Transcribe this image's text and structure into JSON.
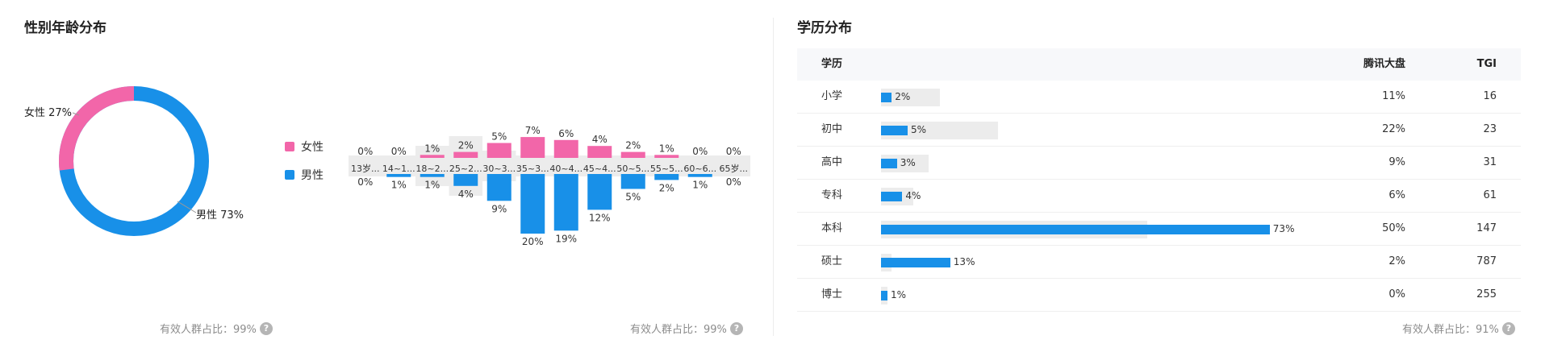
{
  "gender_age": {
    "title": "性别年龄分布",
    "donut": {
      "female_label": "女性 27%",
      "male_label": "男性 73%",
      "female_share": 27,
      "male_share": 73
    },
    "legend": {
      "female": "女性",
      "male": "男性"
    },
    "footer": "有效人群占比：99%"
  },
  "age_chart": {
    "footer": "有效人群占比：99%"
  },
  "education": {
    "title": "学历分布",
    "headers": {
      "name": "学历",
      "tencent": "腾讯大盘",
      "tgi": "TGI"
    },
    "rows": [
      {
        "name": "小学",
        "value": "2%",
        "tencent": "11%",
        "tgi": "16"
      },
      {
        "name": "初中",
        "value": "5%",
        "tencent": "22%",
        "tgi": "23"
      },
      {
        "name": "高中",
        "value": "3%",
        "tencent": "9%",
        "tgi": "31"
      },
      {
        "name": "专科",
        "value": "4%",
        "tencent": "6%",
        "tgi": "61"
      },
      {
        "name": "本科",
        "value": "73%",
        "tencent": "50%",
        "tgi": "147"
      },
      {
        "name": "硕士",
        "value": "13%",
        "tencent": "2%",
        "tgi": "787"
      },
      {
        "name": "博士",
        "value": "1%",
        "tencent": "0%",
        "tgi": "255"
      }
    ],
    "footer": "有效人群占比：91%"
  },
  "colors": {
    "female": "#f266a9",
    "male": "#1890e8",
    "bg_bar": "#ececec"
  },
  "icons": {
    "help": "question-circle-icon"
  },
  "chart_data": [
    {
      "type": "pie",
      "title": "性别年龄分布",
      "categories": [
        "女性",
        "男性"
      ],
      "values": [
        27,
        73
      ]
    },
    {
      "type": "bar",
      "categories": [
        "13岁...",
        "14~1...",
        "18~2...",
        "25~2...",
        "30~3...",
        "35~3...",
        "40~4...",
        "45~4...",
        "50~5...",
        "55~5...",
        "60~6...",
        "65岁..."
      ],
      "series": [
        {
          "name": "女性",
          "values": [
            0,
            0,
            1,
            2,
            5,
            7,
            6,
            4,
            2,
            1,
            0,
            0
          ]
        },
        {
          "name": "男性",
          "values": [
            0,
            1,
            1,
            4,
            9,
            20,
            19,
            12,
            5,
            2,
            1,
            0
          ]
        }
      ],
      "tgi_background": [
        1,
        1,
        3,
        5,
        2,
        1,
        1,
        1,
        1,
        1,
        1,
        1
      ]
    },
    {
      "type": "bar",
      "title": "学历分布",
      "categories": [
        "小学",
        "初中",
        "高中",
        "专科",
        "本科",
        "硕士",
        "博士"
      ],
      "series": [
        {
          "values": [
            2,
            5,
            3,
            4,
            73,
            13,
            1
          ]
        },
        {
          "name": "腾讯大盘",
          "values": [
            11,
            22,
            9,
            6,
            50,
            2,
            0
          ]
        }
      ]
    }
  ]
}
